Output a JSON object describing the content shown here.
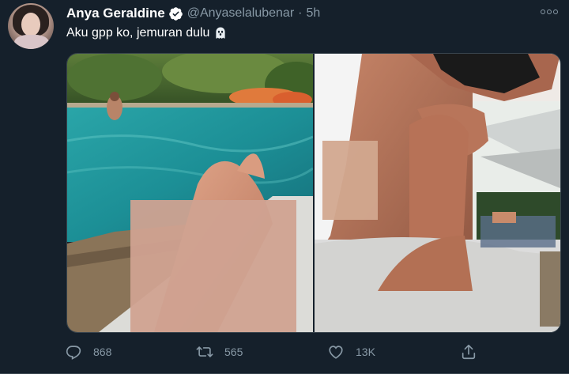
{
  "author": {
    "display_name": "Anya Geraldine",
    "verified": true,
    "handle": "@Anyaselalubenar",
    "separator": "·",
    "time": "5h"
  },
  "tweet": {
    "text": "Aku gpp ko, jemuran dulu",
    "emoji_icon": "ghost-icon"
  },
  "media": {
    "photos": [
      {
        "subject": "pool-legs-photo"
      },
      {
        "subject": "sunglasses-lounger-photo"
      }
    ]
  },
  "actions": {
    "reply": {
      "icon": "reply-icon",
      "count": "868"
    },
    "retweet": {
      "icon": "retweet-icon",
      "count": "565"
    },
    "like": {
      "icon": "heart-icon",
      "count": "13K"
    },
    "share": {
      "icon": "share-icon",
      "count": ""
    }
  },
  "colors": {
    "background": "#15202b",
    "secondary_text": "#8899a6",
    "primary_text": "#ffffff",
    "verified": "#ffffff",
    "border": "#38444d"
  }
}
